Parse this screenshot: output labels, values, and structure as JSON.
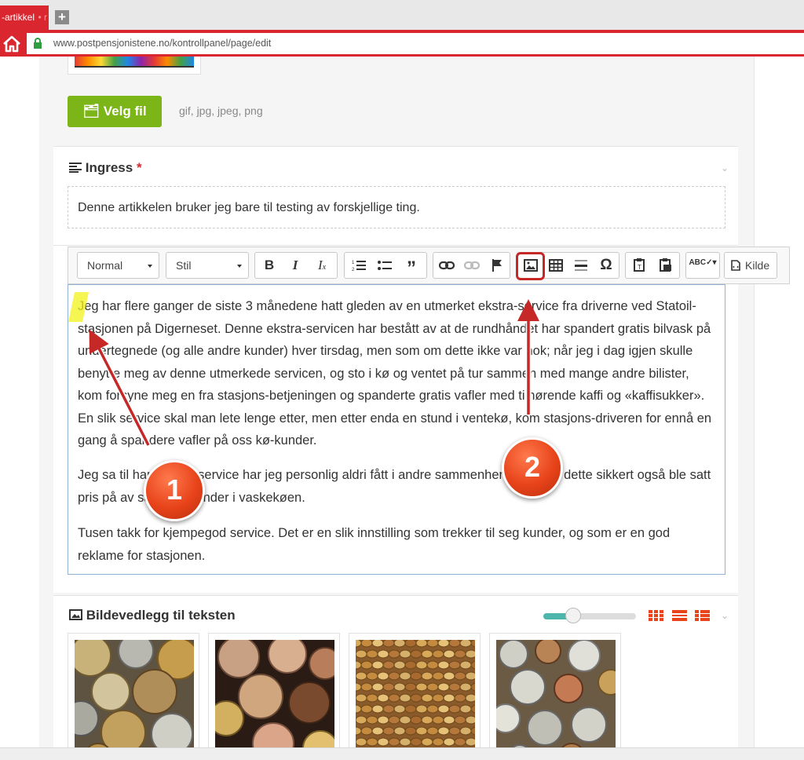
{
  "browser": {
    "tab_title": "-artikkel",
    "tab_dot": "• r",
    "url": "www.postpensjonistene.no/kontrollpanel/page/edit"
  },
  "upload": {
    "button_label": "Velg fil",
    "formats": "gif, jpg, jpeg, png"
  },
  "ingress": {
    "title": "Ingress",
    "required_mark": "*",
    "text": "Denne artikkelen bruker jeg bare til testing av forskjellige ting."
  },
  "toolbar": {
    "format_select": "Normal",
    "style_select": "Stil",
    "source_label": "Kilde"
  },
  "editor": {
    "paragraphs": [
      "Jeg har flere ganger de siste 3 månedene hatt gleden av en utmerket ekstra-service fra driverne ved Statoil-stasjonen på Digerneset. Denne ekstra-servicen har bestått av at de rundhåndet har spandert gratis bilvask på undertegnede (og alle andre kunder) hver tirsdag, men som om dette ikke var nok; når jeg i dag igjen skulle benytte meg av denne utmerkede servicen, og sto i kø og ventet på tur sammen med mange andre bilister, kom forsyne meg en fra stasjons-betjeningen og spanderte gratis vafler med tilhørende kaffi og «kaffisukker». En slik service skal man lete lenge etter, men etter enda en stund i ventekø, kom stasjons-driveren for ennå en gang å spandere vafler på oss kø-kunder.",
      "Jeg sa til ham at slik service har jeg personlig aldri fått i andre sammenhenger, og at dette sikkert også ble satt pris på av samtlige kunder i vaskekøen.",
      "Tusen takk for kjempegod service. Det er en slik innstilling som trekker til seg kunder, og som er en god reklame for stasjonen."
    ]
  },
  "attachments": {
    "title": "Bildevedlegg til teksten",
    "zoom_level": 0.32,
    "images": [
      "coins-1",
      "coins-2",
      "coins-3",
      "coins-4"
    ]
  },
  "annotations": {
    "badge_1": "1",
    "badge_2": "2"
  },
  "colors": {
    "brand_red": "#d9262f",
    "upload_green": "#7cb518",
    "badge_orange": "#e8431a",
    "highlight_yellow": "#f2f21a"
  }
}
